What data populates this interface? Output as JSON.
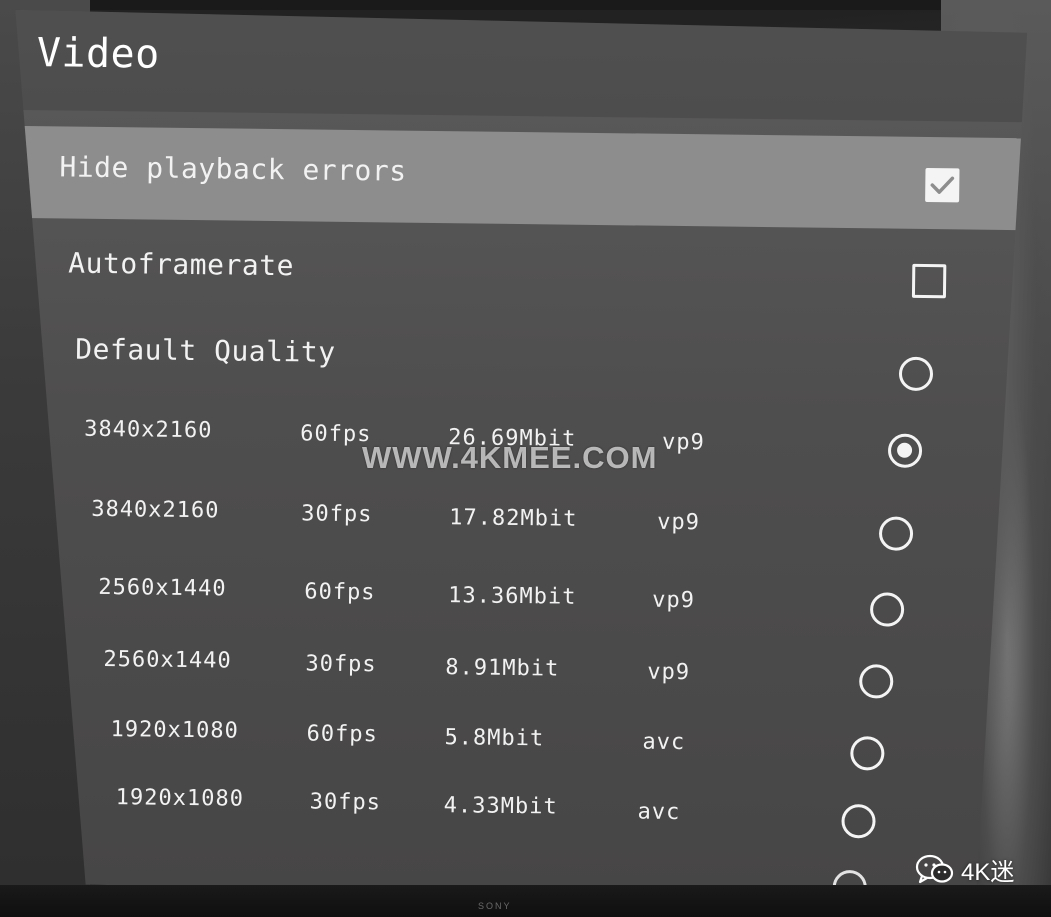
{
  "panel": {
    "title": "Video"
  },
  "options": {
    "hide_errors": {
      "label": "Hide playback errors",
      "checked": true
    },
    "autoframerate": {
      "label": "Autoframerate",
      "checked": false
    },
    "default_quality": {
      "label": "Default Quality",
      "selected": false
    }
  },
  "quality_options": [
    {
      "resolution": "3840x2160",
      "fps": "60fps",
      "bitrate": "26.69Mbit",
      "codec": "vp9",
      "selected": true
    },
    {
      "resolution": "3840x2160",
      "fps": "30fps",
      "bitrate": "17.82Mbit",
      "codec": "vp9",
      "selected": false
    },
    {
      "resolution": "2560x1440",
      "fps": "60fps",
      "bitrate": "13.36Mbit",
      "codec": "vp9",
      "selected": false
    },
    {
      "resolution": "2560x1440",
      "fps": "30fps",
      "bitrate": "8.91Mbit",
      "codec": "vp9",
      "selected": false
    },
    {
      "resolution": "1920x1080",
      "fps": "60fps",
      "bitrate": "5.8Mbit",
      "codec": "avc",
      "selected": false
    },
    {
      "resolution": "1920x1080",
      "fps": "30fps",
      "bitrate": "4.33Mbit",
      "codec": "avc",
      "selected": false
    }
  ],
  "overlay": {
    "watermark": "WWW.4KMEE.COM",
    "wechat_account": "4K迷",
    "brand": "SONY"
  },
  "colors": {
    "panel_bg": "#555454",
    "selected_row": "#8e8d8d",
    "text": "#f2f2f2"
  }
}
